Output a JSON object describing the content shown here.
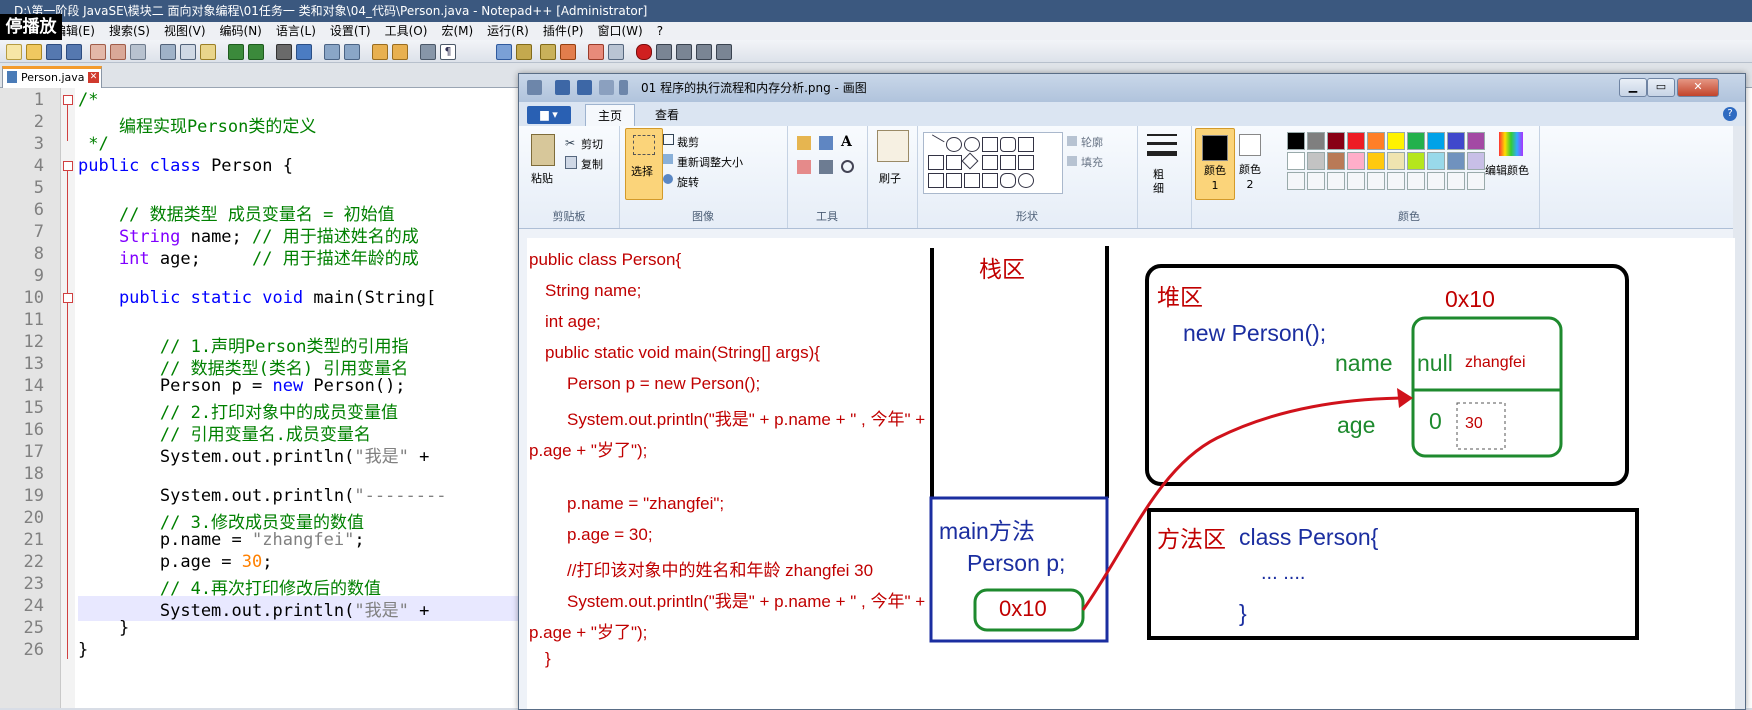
{
  "npp": {
    "title": "D:\\第一阶段 JavaSE\\模块二 面向对象编程\\01任务一 类和对象\\04_代码\\Person.java - Notepad++ [Administrator]",
    "overlay_badge": "停播放",
    "menu": [
      "编辑(E)",
      "搜索(S)",
      "视图(V)",
      "编码(N)",
      "语言(L)",
      "设置(T)",
      "工具(O)",
      "宏(M)",
      "运行(R)",
      "插件(P)",
      "窗口(W)",
      "?"
    ],
    "tab": {
      "label": "Person.java"
    },
    "line_numbers": [
      "1",
      "2",
      "3",
      "4",
      "5",
      "6",
      "7",
      "8",
      "9",
      "10",
      "11",
      "12",
      "13",
      "14",
      "15",
      "16",
      "17",
      "18",
      "19",
      "20",
      "21",
      "22",
      "23",
      "24",
      "25",
      "26"
    ],
    "lines": {
      "l1": "/*",
      "l2": "    编程实现Person类的定义",
      "l3": " */",
      "l4_kw": "public class",
      "l4_rest": " Person {",
      "l6": "    // 数据类型 成员变量名 = 初始值",
      "l7_ty": "    String",
      "l7_rest": " name; ",
      "l7_cm": "// 用于描述姓名的成",
      "l8_ty": "    int",
      "l8_rest": " age;     ",
      "l8_cm": "// 用于描述年龄的成",
      "l10_kw": "    public static void",
      "l10_rest": " main(String[",
      "l12": "        // 1.声明Person类型的引用指",
      "l13": "        // 数据类型(类名) 引用变量名",
      "l14_a": "        Person p = ",
      "l14_kw": "new",
      "l14_b": " Person();",
      "l15": "        // 2.打印对象中的成员变量值",
      "l16": "        // 引用变量名.成员变量名",
      "l17_a": "        System.out.println(",
      "l17_st": "\"我是\"",
      "l17_b": " +",
      "l19_a": "        System.out.println(",
      "l19_st": "\"--------",
      "l20": "        // 3.修改成员变量的数值",
      "l21_a": "        p.name = ",
      "l21_st": "\"zhangfei\"",
      "l21_b": ";",
      "l22_a": "        p.age = ",
      "l22_nm": "30",
      "l22_b": ";",
      "l23": "        // 4.再次打印修改后的数值",
      "l24_a": "        System.out.println(",
      "l24_st": "\"我是\"",
      "l24_b": " +",
      "l25": "    }",
      "l26": "}"
    }
  },
  "paint": {
    "title": "01 程序的执行流程和内存分析.png - 画图",
    "file_menu": "▆ ▾",
    "tabs": [
      "主页",
      "查看"
    ],
    "groups": {
      "clipboard": {
        "name": "剪贴板",
        "paste": "粘贴",
        "cut": "剪切",
        "copy": "复制"
      },
      "image": {
        "name": "图像",
        "select": "选择",
        "crop": "裁剪",
        "resize": "重新调整大小",
        "rotate": "旋转"
      },
      "tools": {
        "name": "工具"
      },
      "brush": {
        "label": "刷子"
      },
      "shapes": {
        "name": "形状",
        "outline": "轮廓",
        "fill": "填充"
      },
      "size": {
        "label": "粗细"
      },
      "color1": "颜色 1",
      "color2": "颜色 2",
      "colors": {
        "name": "颜色",
        "edit": "编辑颜色"
      }
    },
    "palette": [
      "#000000",
      "#7f7f7f",
      "#880015",
      "#ed1c24",
      "#ff7f27",
      "#fff200",
      "#22b14c",
      "#00a2e8",
      "#3f48cc",
      "#a349a4",
      "#ffffff",
      "#c3c3c3",
      "#b97a57",
      "#ffaec9",
      "#ffc90e",
      "#efe4b0",
      "#b5e61d",
      "#99d9ea",
      "#7092be",
      "#c8bfe7"
    ]
  },
  "diagram": {
    "code": [
      "public class Person{",
      "String name;",
      "int age;",
      "public static void main(String[] args){",
      "Person p = new Person();",
      "System.out.println(\"我是\" + p.name + \" , 今年\" +",
      "p.age + \"岁了\");",
      "p.name = \"zhangfei\";",
      "p.age = 30;",
      "//打印该对象中的姓名和年龄    zhangfei  30",
      "System.out.println(\"我是\" + p.name + \" , 今年\" +",
      "p.age + \"岁了\");",
      "}"
    ],
    "stack_label": "栈区",
    "main_frame": "main方法",
    "ref_var": "Person p;",
    "ref_value": "0x10",
    "heap_label": "堆区",
    "heap_addr": "0x10",
    "new_expr": "new Person();",
    "field_name": "name",
    "field_age": "age",
    "name_value": "null",
    "name_new": "zhangfei",
    "age_value": "0",
    "age_new": "30",
    "method_area_label": "方法区",
    "class_decl": "class Person{",
    "class_body": "... ....",
    "class_close": "}"
  }
}
